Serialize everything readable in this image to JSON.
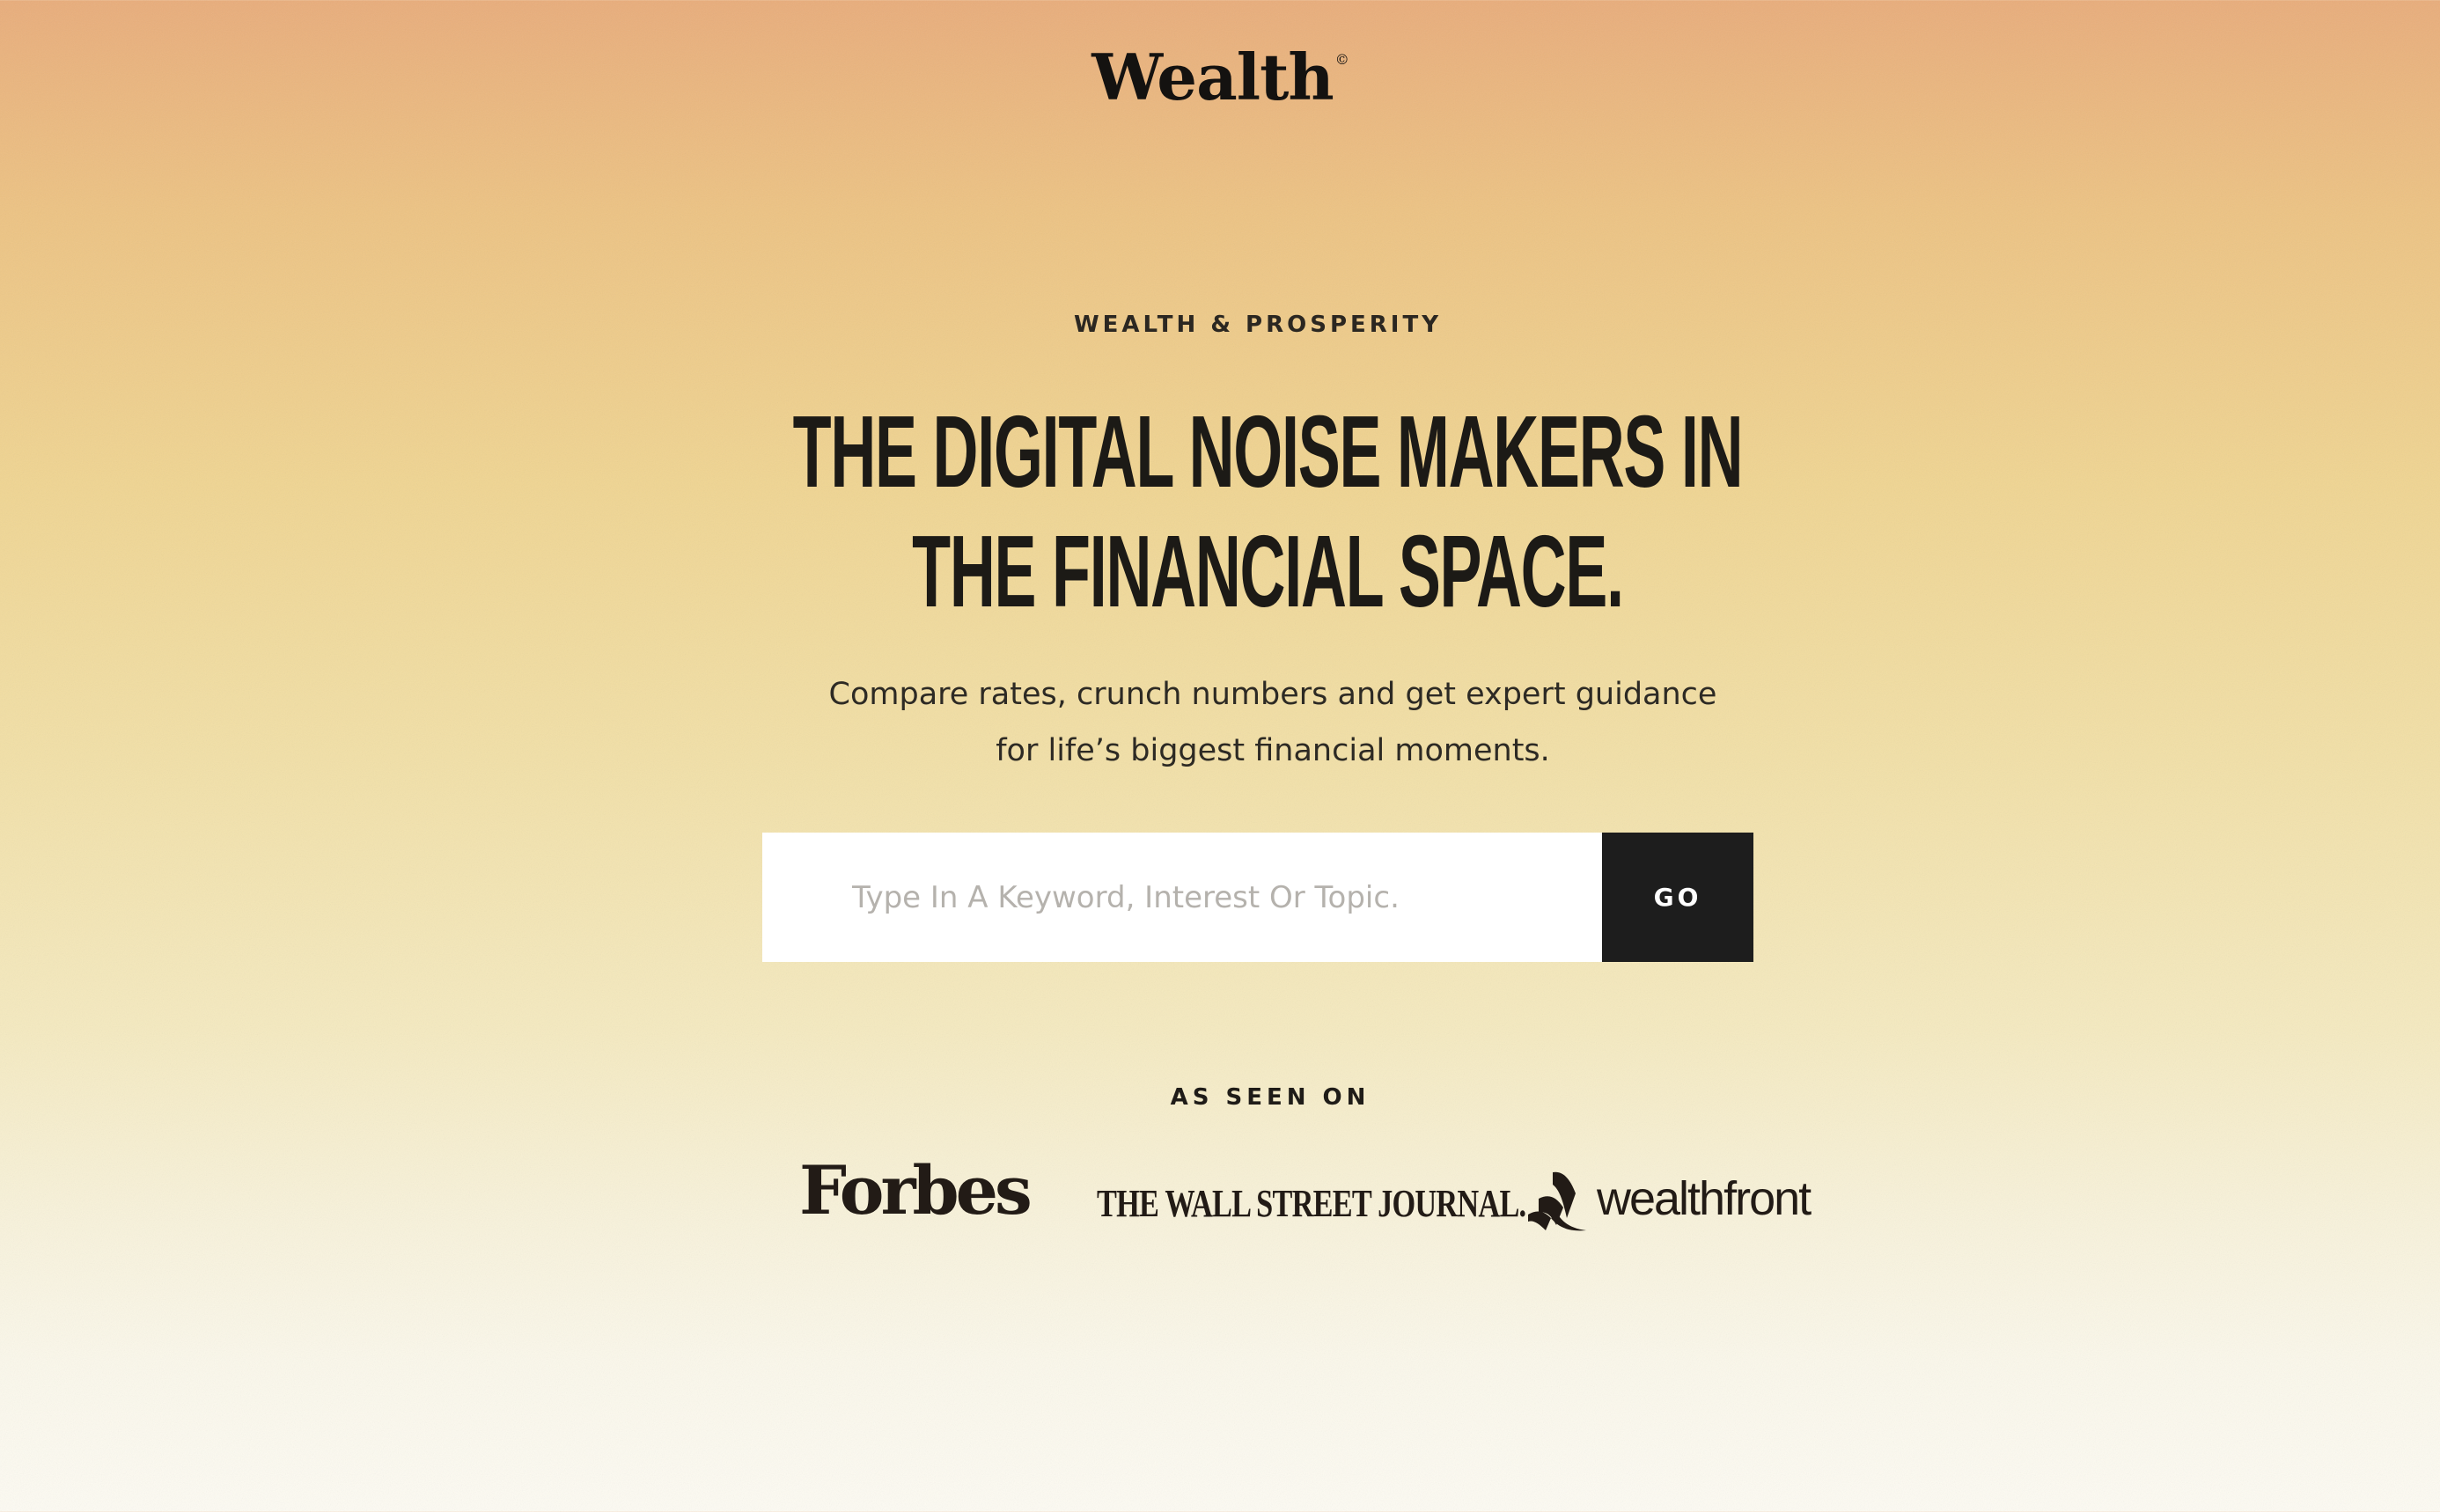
{
  "brand": {
    "name": "Wealth",
    "registered_mark": "©"
  },
  "hero": {
    "eyebrow": "WEALTH & PROSPERITY",
    "headline_line1": "THE DIGITAL NOISE MAKERS IN",
    "headline_line2": "THE FINANCIAL SPACE.",
    "subtext_line1": "Compare rates, crunch numbers and get expert guidance",
    "subtext_line2": "for life’s biggest financial moments."
  },
  "search": {
    "placeholder": "Type In A Keyword, Interest Or Topic.",
    "value": "",
    "button_label": "GO"
  },
  "press": {
    "heading": "AS SEEN ON",
    "logos": [
      "Forbes",
      "THE WALL STREET JOURNAL.",
      "wealthfront"
    ]
  },
  "colors": {
    "gradient_top": "#e9ad7b",
    "gradient_mid": "#f0d592",
    "gradient_bottom": "#fdfbf3",
    "text_dark": "#1c1a16",
    "button_bg": "#1d1d1d",
    "button_text": "#ffffff"
  },
  "icons": {
    "wealthfront_mark": "wealthfront-logo-icon"
  }
}
